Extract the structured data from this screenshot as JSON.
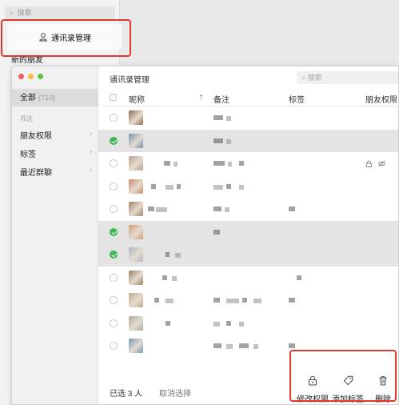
{
  "background": {
    "search_placeholder": "搜索",
    "manage_label": "通讯录管理",
    "new_friends_label": "新的朋友"
  },
  "window": {
    "title": "通讯录管理",
    "search_placeholder": "搜索",
    "traffic_lights": [
      "#ed5f58",
      "#f6bd3b",
      "#5fc43f"
    ]
  },
  "sidebar": {
    "all_label": "全部",
    "all_count": "(710)",
    "filter_label": "筛选",
    "items": [
      {
        "label": "朋友权限",
        "chevron": "›"
      },
      {
        "label": "标签",
        "chevron": "›"
      },
      {
        "label": "最近群聊",
        "chevron": "›"
      }
    ]
  },
  "table": {
    "columns": {
      "nickname": "昵称",
      "sort_arrow": "↑",
      "remark": "备注",
      "tag": "标签",
      "friend_permission": "朋友权限"
    },
    "rows": [
      {
        "selected": false,
        "avatar": "#8b6b4f"
      },
      {
        "selected": true,
        "avatar": "#6f8fb0"
      },
      {
        "selected": false,
        "avatar": "#b8a08f",
        "permission_icons": [
          "lock-icon",
          "eye-off-icon"
        ]
      },
      {
        "selected": false,
        "avatar": "#c98a6b"
      },
      {
        "selected": false,
        "avatar": "#a0826a"
      },
      {
        "selected": true,
        "avatar": "#d29a7c"
      },
      {
        "selected": true,
        "avatar": "#a9b7c8"
      },
      {
        "selected": false,
        "avatar": "#9b8065"
      },
      {
        "selected": false,
        "avatar": "#bfa890"
      },
      {
        "selected": false,
        "avatar": "#a8a8a0"
      },
      {
        "selected": false,
        "avatar": "#6a9ab5"
      }
    ]
  },
  "footer": {
    "selected_text": "已选 3 人",
    "cancel_label": "取消选择",
    "actions": {
      "edit_permission": "修改权限",
      "add_tag": "添加标签",
      "delete": "删除"
    }
  },
  "colors": {
    "accent_green": "#3fb654",
    "highlight_red": "#e03a30"
  }
}
